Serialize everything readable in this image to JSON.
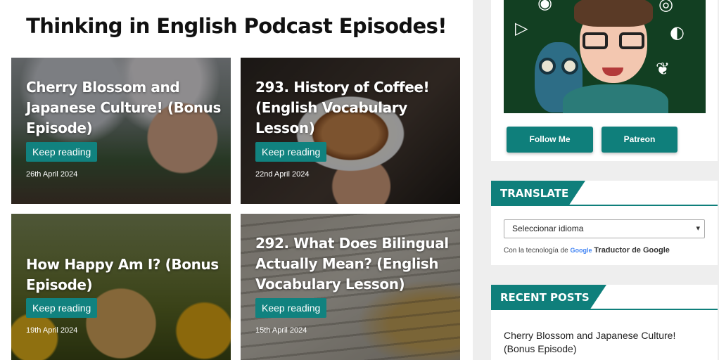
{
  "main": {
    "page_title": "Thinking in English Podcast Episodes!",
    "posts": [
      {
        "title": "Cherry Blossom and Japanese Culture! (Bonus Episode)",
        "button": "Keep reading",
        "date": "26th April 2024"
      },
      {
        "title": "293. History of Coffee! (English Vocabulary Lesson)",
        "button": "Keep reading",
        "date": "22nd April 2024"
      },
      {
        "title": "How Happy Am I? (Bonus Episode)",
        "button": "Keep reading",
        "date": "19th April 2024"
      },
      {
        "title": "292. What Does Bilingual Actually Mean? (English Vocabulary Lesson)",
        "button": "Keep reading",
        "date": "15th April 2024"
      }
    ]
  },
  "sidebar": {
    "profile": {
      "follow_button": "Follow Me",
      "patreon_button": "Patreon",
      "social_icons": [
        "spotify-icon",
        "instagram-icon",
        "play-icon",
        "patreon-icon",
        "twitter-icon"
      ]
    },
    "translate": {
      "heading": "TRANSLATE",
      "select_value": "Seleccionar idioma",
      "powered_prefix": "Con la tecnología de",
      "google": "Google",
      "powered_suffix": "Traductor de Google"
    },
    "recent": {
      "heading": "RECENT POSTS",
      "items": [
        "Cherry Blossom and Japanese Culture! (Bonus Episode)"
      ]
    }
  },
  "colors": {
    "accent": "#0f7f7b",
    "sidebar_bg": "#eeeeee"
  }
}
